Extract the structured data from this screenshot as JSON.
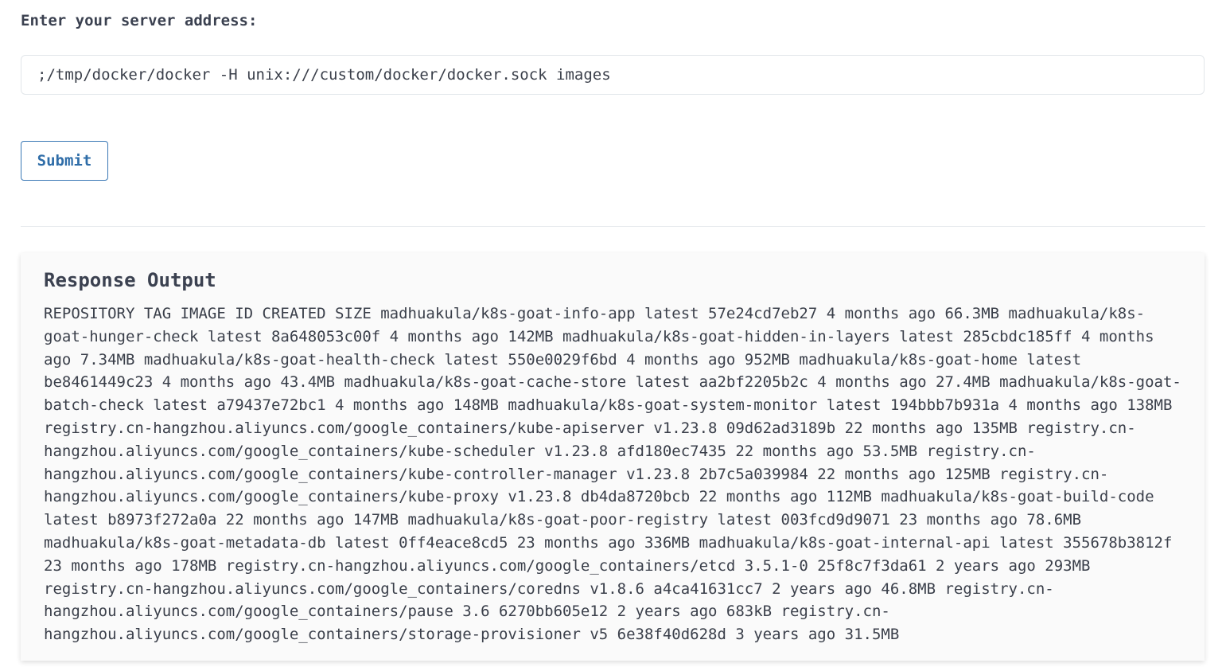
{
  "form": {
    "label": "Enter your server address:",
    "input_value": ";/tmp/docker/docker -H unix:///custom/docker/docker.sock images",
    "submit_label": "Submit"
  },
  "output": {
    "title": "Response Output",
    "text": "REPOSITORY TAG IMAGE ID CREATED SIZE madhuakula/k8s-goat-info-app latest 57e24cd7eb27 4 months ago 66.3MB madhuakula/k8s-goat-hunger-check latest 8a648053c00f 4 months ago 142MB madhuakula/k8s-goat-hidden-in-layers latest 285cbdc185ff 4 months ago 7.34MB madhuakula/k8s-goat-health-check latest 550e0029f6bd 4 months ago 952MB madhuakula/k8s-goat-home latest be8461449c23 4 months ago 43.4MB madhuakula/k8s-goat-cache-store latest aa2bf2205b2c 4 months ago 27.4MB madhuakula/k8s-goat-batch-check latest a79437e72bc1 4 months ago 148MB madhuakula/k8s-goat-system-monitor latest 194bbb7b931a 4 months ago 138MB registry.cn-hangzhou.aliyuncs.com/google_containers/kube-apiserver v1.23.8 09d62ad3189b 22 months ago 135MB registry.cn-hangzhou.aliyuncs.com/google_containers/kube-scheduler v1.23.8 afd180ec7435 22 months ago 53.5MB registry.cn-hangzhou.aliyuncs.com/google_containers/kube-controller-manager v1.23.8 2b7c5a039984 22 months ago 125MB registry.cn-hangzhou.aliyuncs.com/google_containers/kube-proxy v1.23.8 db4da8720bcb 22 months ago 112MB madhuakula/k8s-goat-build-code latest b8973f272a0a 22 months ago 147MB madhuakula/k8s-goat-poor-registry latest 003fcd9d9071 23 months ago 78.6MB madhuakula/k8s-goat-metadata-db latest 0ff4eace8cd5 23 months ago 336MB madhuakula/k8s-goat-internal-api latest 355678b3812f 23 months ago 178MB registry.cn-hangzhou.aliyuncs.com/google_containers/etcd 3.5.1-0 25f8c7f3da61 2 years ago 293MB registry.cn-hangzhou.aliyuncs.com/google_containers/coredns v1.8.6 a4ca41631cc7 2 years ago 46.8MB registry.cn-hangzhou.aliyuncs.com/google_containers/pause 3.6 6270bb605e12 2 years ago 683kB registry.cn-hangzhou.aliyuncs.com/google_containers/storage-provisioner v5 6e38f40d628d 3 years ago 31.5MB"
  }
}
